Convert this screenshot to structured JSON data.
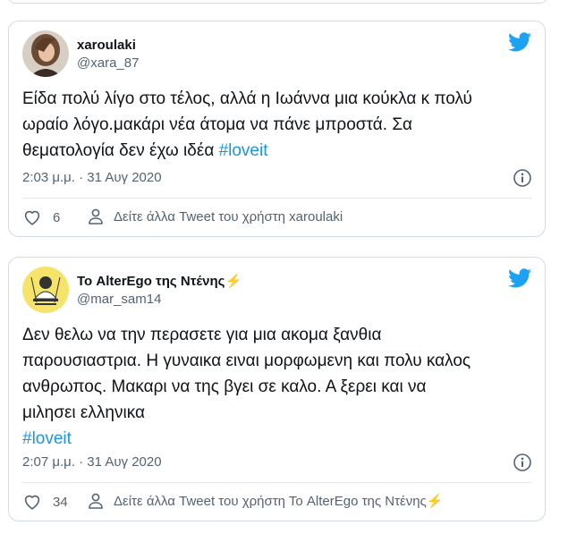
{
  "tweets": [
    {
      "name": "xaroulaki",
      "name_suffix": "",
      "handle": "@xara_87",
      "text_lines": [
        "Είδα πολύ λίγο στο τέλος, αλλά η Ιωάννα μια κούκλα κ πολύ",
        "ωραίο λόγο.μακάρι νέα άτομα να πάνε μπροστά. Σα",
        "θεματολογία δεν έχω ιδέα "
      ],
      "hashtag": "#loveit",
      "timestamp": "2:03 μ.μ. · 31 Αυγ 2020",
      "likes": "6",
      "more_label": "Δείτε άλλα Tweet του χρήστη xaroulaki"
    },
    {
      "name": "Το AlterEgo της Ντένης",
      "name_suffix": "⚡",
      "handle": "@mar_sam14",
      "text_lines": [
        "Δεν θελω να την περασετε για μια ακομα ξανθια",
        "παρουσιαστρια. Η γυναικα ειναι μορφωμενη και πολυ καλος",
        "ανθρωπος. Μακαρι να της βγει σε καλο. Α ξερει και να",
        "μιλησει ελληνικα"
      ],
      "hashtag": "#loveit",
      "timestamp": "2:07 μ.μ. · 31 Αυγ 2020",
      "likes": "34",
      "more_label": "Δείτε άλλα Tweet του χρήστη Το AlterEgo της Ντένης",
      "more_suffix": "⚡"
    }
  ],
  "colors": {
    "brand": "#1da1f2",
    "hashtag": "#1b95e0",
    "secondary_text": "#536471",
    "border": "#d3dbe2"
  },
  "icons": [
    "twitter-bird-icon",
    "info-icon",
    "heart-icon",
    "person-icon",
    "lightning-icon"
  ]
}
